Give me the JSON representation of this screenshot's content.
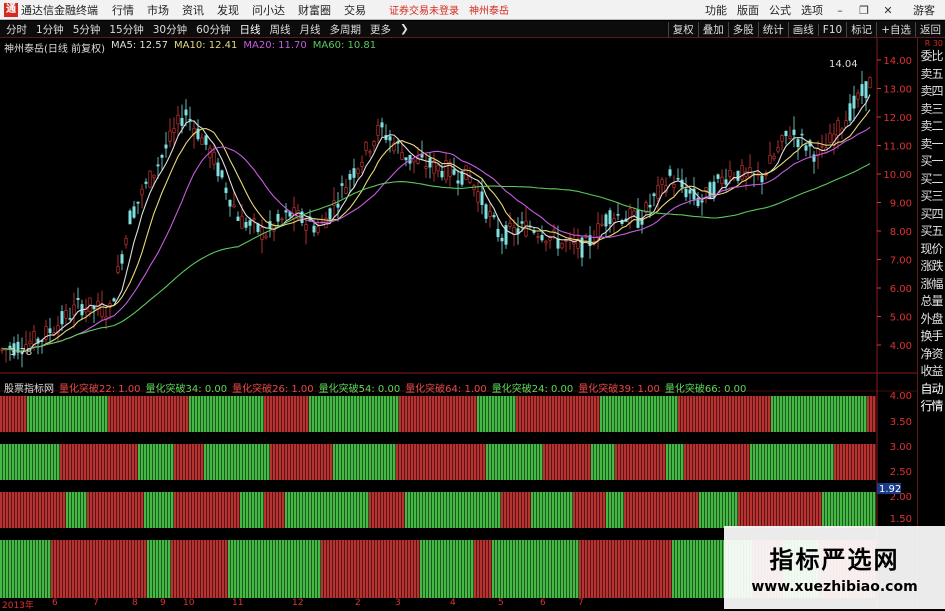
{
  "titlebar": {
    "app_title": "通达信金融终端",
    "menus": [
      "行情",
      "市场",
      "资讯",
      "发现",
      "问小达",
      "财富圈",
      "交易"
    ],
    "notice": "证券交易未登录",
    "stock_tag": "神州泰岳",
    "right_menus": [
      "功能",
      "版面",
      "公式",
      "选项"
    ],
    "guest": "游客"
  },
  "toolbar": {
    "periods": [
      "分时",
      "1分钟",
      "5分钟",
      "15分钟",
      "30分钟",
      "60分钟",
      "日线",
      "周线",
      "月线",
      "多周期",
      "更多"
    ],
    "right_buttons": [
      "复权",
      "叠加",
      "多股",
      "统计",
      "画线",
      "F10",
      "标记",
      "+自选",
      "返回"
    ]
  },
  "info": {
    "stock": "神州泰岳(日线 前复权)",
    "ma5": "MA5: 12.57",
    "ma10": "MA10: 12.41",
    "ma20": "MA20: 11.70",
    "ma60": "MA60: 10.81"
  },
  "price_axis": [
    "14.00",
    "13.00",
    "12.00",
    "11.00",
    "10.00",
    "9.00",
    "8.00",
    "7.00",
    "6.00",
    "5.00",
    "4.00"
  ],
  "price_marks": {
    "high": "14.04",
    "low": "3.78"
  },
  "indicator": {
    "name": "股票指标网",
    "items": [
      {
        "label": "量化突破22: 1.00",
        "color": "red"
      },
      {
        "label": "量化突破34: 0.00",
        "color": "green"
      },
      {
        "label": "量化突破26: 1.00",
        "color": "red"
      },
      {
        "label": "量化突破54: 0.00",
        "color": "green"
      },
      {
        "label": "量化突破64: 1.00",
        "color": "red"
      },
      {
        "label": "量化突破24: 0.00",
        "color": "green"
      },
      {
        "label": "量化突破39: 1.00",
        "color": "red"
      },
      {
        "label": "量化突破66: 0.00",
        "color": "green"
      }
    ],
    "axis": [
      "4.00",
      "3.50",
      "3.00",
      "2.50",
      "2.00",
      "1.92",
      "1.50"
    ]
  },
  "xaxis": [
    "2013年",
    "6",
    "7",
    "8",
    "9",
    "10",
    "11",
    "12",
    "2",
    "3",
    "4",
    "5",
    "6",
    "7"
  ],
  "sidepanel": [
    "委比",
    "卖五",
    "卖四",
    "卖三",
    "卖二",
    "卖一",
    "买一",
    "买二",
    "买三",
    "买四",
    "买五",
    "现价",
    "涨跌",
    "涨幅",
    "总量",
    "外盘",
    "换手",
    "净资",
    "收益",
    "自动",
    "行情"
  ],
  "sidepanel_label": "R 30",
  "watermark": {
    "title": "指标严选网",
    "url": "www.xuezhibiao.com"
  },
  "colors": {
    "up": "#d83a3a",
    "down": "#3ec43e",
    "ma5": "#dddddd",
    "ma10": "#e6d97a",
    "ma20": "#c65ce0",
    "ma60": "#5cc85c"
  }
}
